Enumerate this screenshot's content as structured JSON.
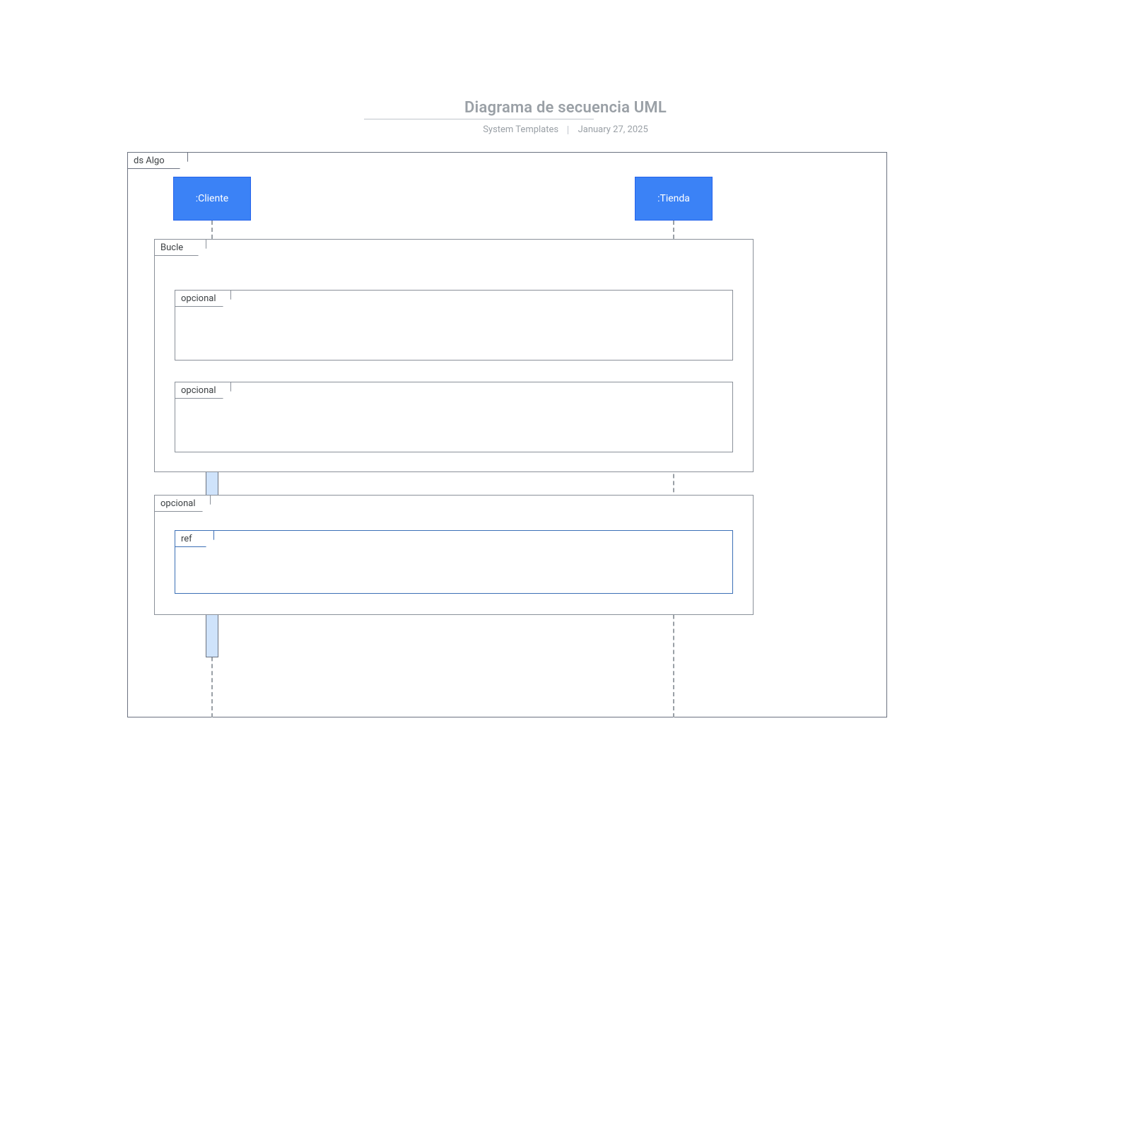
{
  "header": {
    "title": "Diagrama de secuencia UML",
    "author": "System Templates",
    "date": "January 27, 2025"
  },
  "diagram": {
    "outer_label": "ds Algo",
    "actors": {
      "cliente": ":Cliente",
      "tienda": ":Tienda"
    },
    "fragments": {
      "loop": "Bucle",
      "opt1": "opcional",
      "opt2": "opcional",
      "opt3": "opcional",
      "ref": "ref"
    }
  },
  "colors": {
    "actor_fill": "#3b82f6",
    "actor_border": "#2563eb",
    "activation_fill": "#cfe3fb",
    "line": "#6b7280"
  }
}
